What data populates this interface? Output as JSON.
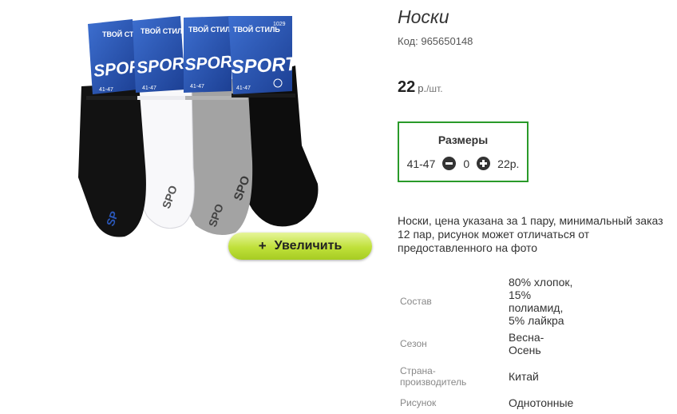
{
  "product": {
    "title": "Носки",
    "code_label": "Код:",
    "code": "965650148",
    "price": "22",
    "currency": "р.",
    "unit": "/шт."
  },
  "image": {
    "zoom_plus": "+",
    "zoom_label": "Увеличить",
    "package_brand": "ТВОЙ СТИЛЬ",
    "package_logo": "SPORT",
    "package_size": "41-47",
    "package_article": "1029",
    "sock_colors": [
      "#121212",
      "#f8f8fa",
      "#a3a3a3",
      "#0d0d0d"
    ],
    "label_color": "#2a57b8"
  },
  "sizes": {
    "title": "Размеры",
    "rows": [
      {
        "size": "41-47",
        "qty": "0",
        "price": "22р."
      }
    ]
  },
  "description": "Носки, цена указана за 1 пару, минимальный заказ 12 пар, рисунок может отличаться от предоставленного на фото",
  "properties": [
    {
      "name": "Состав",
      "value": "80% хлопок,\n15%\nполиамид,\n5% лайкра"
    },
    {
      "name": "Сезон",
      "value": "Весна-\nОсень"
    },
    {
      "name": "Страна-\nпроизводитель",
      "value": "Китай"
    },
    {
      "name": "Рисунок",
      "value": "Однотонные"
    }
  ],
  "colors": {
    "accent_green": "#2a9a2a",
    "zoom_button": "#bfe03a"
  }
}
